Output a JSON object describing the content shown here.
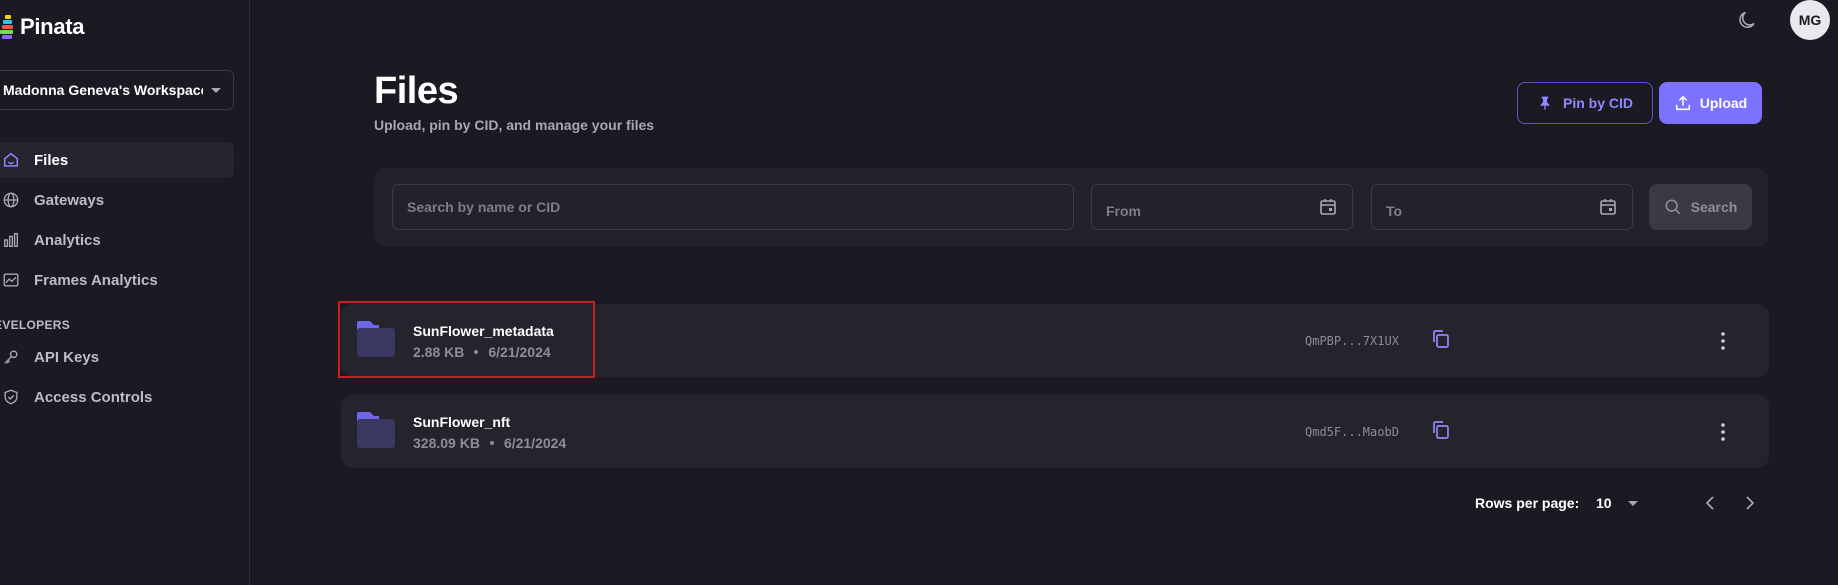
{
  "brand": {
    "name": "Pinata"
  },
  "sidebar": {
    "workspace": "Madonna Geneva's Workspace",
    "items": [
      {
        "label": "Files",
        "icon": "home-icon",
        "active": true
      },
      {
        "label": "Gateways",
        "icon": "globe-icon",
        "active": false
      },
      {
        "label": "Analytics",
        "icon": "bar-chart-icon",
        "active": false
      },
      {
        "label": "Frames Analytics",
        "icon": "line-chart-icon",
        "active": false
      }
    ],
    "section_label": "EVELOPERS",
    "dev_items": [
      {
        "label": "API Keys",
        "icon": "key-icon"
      },
      {
        "label": "Access Controls",
        "icon": "shield-icon"
      }
    ]
  },
  "topbar": {
    "avatar_initials": "MG",
    "theme_icon": "moon-icon"
  },
  "header": {
    "title": "Files",
    "subtitle": "Upload, pin by CID, and manage your files",
    "pin_label": "Pin by CID",
    "upload_label": "Upload"
  },
  "filters": {
    "search_placeholder": "Search by name or CID",
    "from_placeholder": "From",
    "to_placeholder": "To",
    "search_button": "Search"
  },
  "files": [
    {
      "name": "SunFlower_metadata",
      "size": "2.88 KB",
      "date": "6/21/2024",
      "cid": "QmPBP...7X1UX"
    },
    {
      "name": "SunFlower_nft",
      "size": "328.09 KB",
      "date": "6/21/2024",
      "cid": "Qmd5F...MaobD"
    }
  ],
  "pagination": {
    "rows_label": "Rows per page:",
    "rows_value": "10"
  },
  "colors": {
    "accent": "#7b73ff",
    "background": "#1b1a22",
    "panel": "#23222b",
    "highlight": "#c42027"
  }
}
